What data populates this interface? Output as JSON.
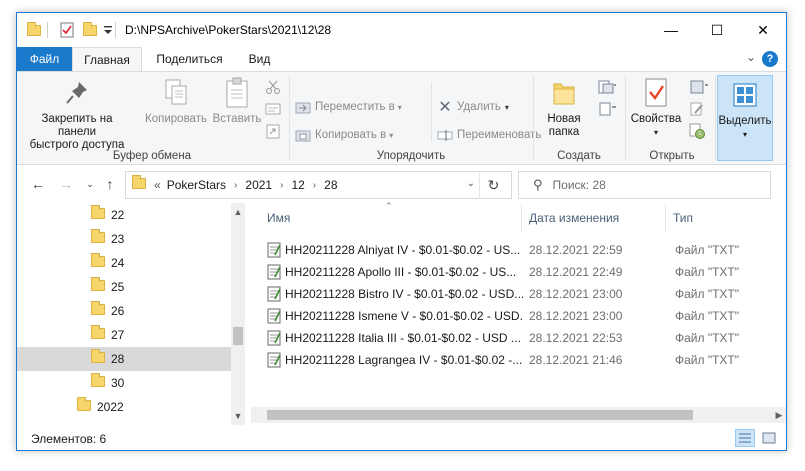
{
  "window": {
    "title": "D:\\NPSArchive\\PokerStars\\2021\\12\\28",
    "minimize": "—",
    "maximize": "☐",
    "close": "✕"
  },
  "menu": {
    "file": "Файл",
    "tabs": [
      "Главная",
      "Поделиться",
      "Вид"
    ],
    "help": "?"
  },
  "ribbon": {
    "clipboard": {
      "pin": "Закрепить на панели быстрого доступа",
      "pin_line1": "Закрепить на панели",
      "pin_line2": "быстрого доступа",
      "copy": "Копировать",
      "paste": "Вставить",
      "label": "Буфер обмена"
    },
    "organize": {
      "move_to": "Переместить в",
      "copy_to": "Копировать в",
      "delete": "Удалить",
      "rename": "Переименовать",
      "label": "Упорядочить"
    },
    "new": {
      "new_folder_line1": "Новая",
      "new_folder_line2": "папка",
      "label": "Создать"
    },
    "open": {
      "properties": "Свойства",
      "label": "Открыть"
    },
    "select": {
      "select": "Выделить"
    }
  },
  "address": {
    "overflow": "«",
    "crumbs": [
      "PokerStars",
      "2021",
      "12",
      "28"
    ]
  },
  "search": {
    "placeholder": "Поиск: 28"
  },
  "tree": {
    "items": [
      {
        "label": "22",
        "selected": false
      },
      {
        "label": "23",
        "selected": false
      },
      {
        "label": "24",
        "selected": false
      },
      {
        "label": "25",
        "selected": false
      },
      {
        "label": "26",
        "selected": false
      },
      {
        "label": "27",
        "selected": false
      },
      {
        "label": "28",
        "selected": true
      },
      {
        "label": "30",
        "selected": false
      },
      {
        "label": "2022",
        "selected": false
      }
    ]
  },
  "columns": {
    "name": "Имя",
    "date": "Дата изменения",
    "type": "Тип"
  },
  "files": [
    {
      "name": "HH20211228 Alniyat IV - $0.01-$0.02 - US...",
      "date": "28.12.2021 22:59",
      "type": "Файл \"TXT\""
    },
    {
      "name": "HH20211228 Apollo III - $0.01-$0.02 - US...",
      "date": "28.12.2021 22:49",
      "type": "Файл \"TXT\""
    },
    {
      "name": "HH20211228 Bistro IV - $0.01-$0.02 - USD...",
      "date": "28.12.2021 23:00",
      "type": "Файл \"TXT\""
    },
    {
      "name": "HH20211228 Ismene V - $0.01-$0.02 - USD...",
      "date": "28.12.2021 23:00",
      "type": "Файл \"TXT\""
    },
    {
      "name": "HH20211228 Italia III - $0.01-$0.02 - USD ...",
      "date": "28.12.2021 22:53",
      "type": "Файл \"TXT\""
    },
    {
      "name": "HH20211228 Lagrangea IV - $0.01-$0.02 -...",
      "date": "28.12.2021 21:46",
      "type": "Файл \"TXT\""
    }
  ],
  "status": {
    "items": "Элементов: 6"
  },
  "colors": {
    "accent": "#1979ca",
    "folder": "#f6d56b",
    "selected_bg": "#d9d9d9"
  }
}
